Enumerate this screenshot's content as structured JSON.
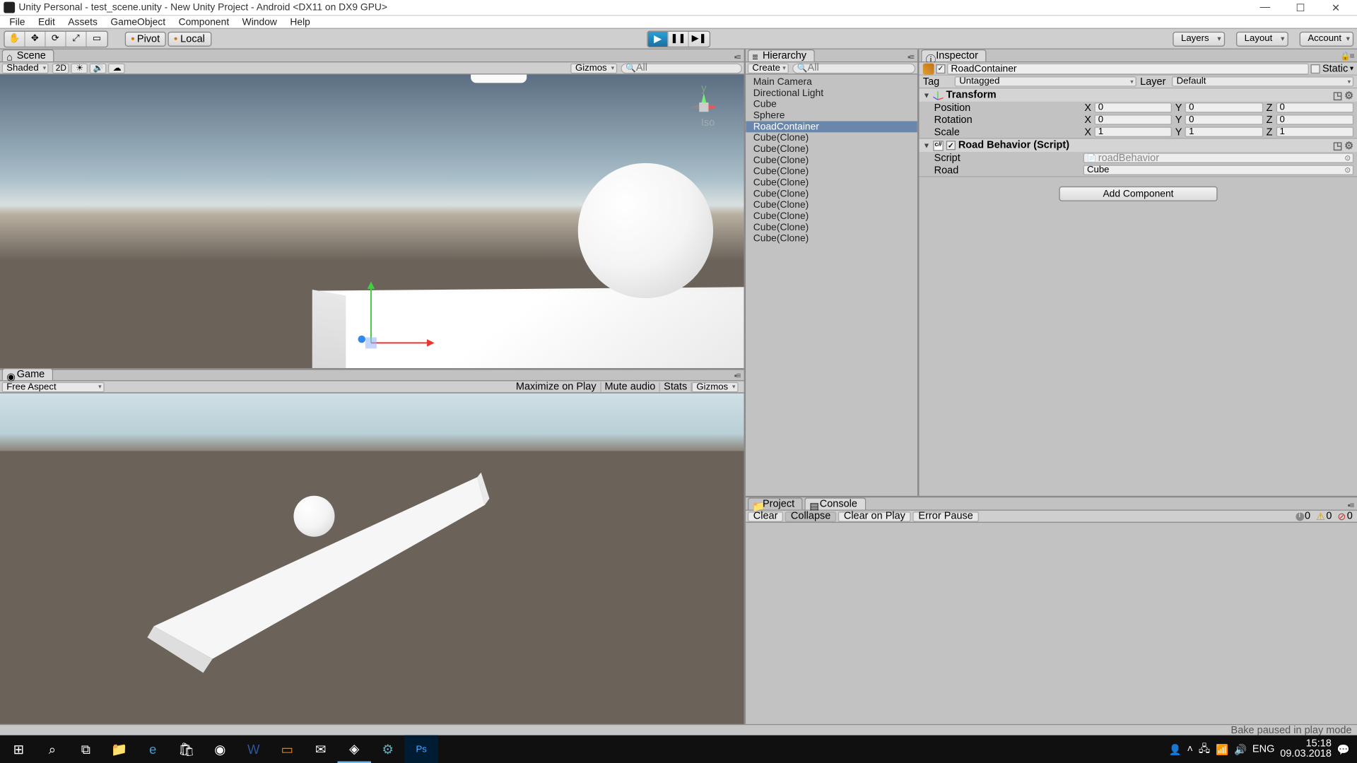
{
  "title": "Unity Personal - test_scene.unity - New Unity Project - Android <DX11 on DX9 GPU>",
  "menu": [
    "File",
    "Edit",
    "Assets",
    "GameObject",
    "Component",
    "Window",
    "Help"
  ],
  "toolbar": {
    "pivot": "Pivot",
    "local": "Local",
    "layers": "Layers",
    "layout": "Layout",
    "account": "Account"
  },
  "scene": {
    "tab": "Scene",
    "shade": "Shaded",
    "twod": "2D",
    "gizmos": "Gizmos",
    "search": "All",
    "iso": "Iso"
  },
  "game": {
    "tab": "Game",
    "aspect": "Free Aspect",
    "maxplay": "Maximize on Play",
    "mute": "Mute audio",
    "stats": "Stats",
    "gizmos": "Gizmos"
  },
  "hierarchy": {
    "tab": "Hierarchy",
    "create": "Create",
    "search": "All",
    "items": [
      {
        "name": "Main Camera",
        "sel": false
      },
      {
        "name": "Directional Light",
        "sel": false
      },
      {
        "name": "Cube",
        "sel": false
      },
      {
        "name": "Sphere",
        "sel": false
      },
      {
        "name": "RoadContainer",
        "sel": true
      },
      {
        "name": "Cube(Clone)",
        "sel": false
      },
      {
        "name": "Cube(Clone)",
        "sel": false
      },
      {
        "name": "Cube(Clone)",
        "sel": false
      },
      {
        "name": "Cube(Clone)",
        "sel": false
      },
      {
        "name": "Cube(Clone)",
        "sel": false
      },
      {
        "name": "Cube(Clone)",
        "sel": false
      },
      {
        "name": "Cube(Clone)",
        "sel": false
      },
      {
        "name": "Cube(Clone)",
        "sel": false
      },
      {
        "name": "Cube(Clone)",
        "sel": false
      },
      {
        "name": "Cube(Clone)",
        "sel": false
      }
    ]
  },
  "inspector": {
    "tab": "Inspector",
    "name": "RoadContainer",
    "static": "Static",
    "tagLbl": "Tag",
    "tag": "Untagged",
    "layerLbl": "Layer",
    "layer": "Default",
    "transform": {
      "title": "Transform",
      "posLbl": "Position",
      "pos": {
        "x": "0",
        "y": "0",
        "z": "0"
      },
      "rotLbl": "Rotation",
      "rot": {
        "x": "0",
        "y": "0",
        "z": "0"
      },
      "sclLbl": "Scale",
      "scl": {
        "x": "1",
        "y": "1",
        "z": "1"
      }
    },
    "roadbeh": {
      "title": "Road Behavior (Script)",
      "scriptLbl": "Script",
      "script": "roadBehavior",
      "roadLbl": "Road",
      "road": "Cube"
    },
    "addcomp": "Add Component"
  },
  "project": {
    "tab": "Project"
  },
  "console": {
    "tab": "Console",
    "clear": "Clear",
    "collapse": "Collapse",
    "clearplay": "Clear on Play",
    "errpause": "Error Pause",
    "info": "0",
    "warn": "0",
    "err": "0"
  },
  "status": "Bake paused in play mode",
  "tray": {
    "lang": "ENG",
    "time": "15:18",
    "date": "09.03.2018"
  }
}
